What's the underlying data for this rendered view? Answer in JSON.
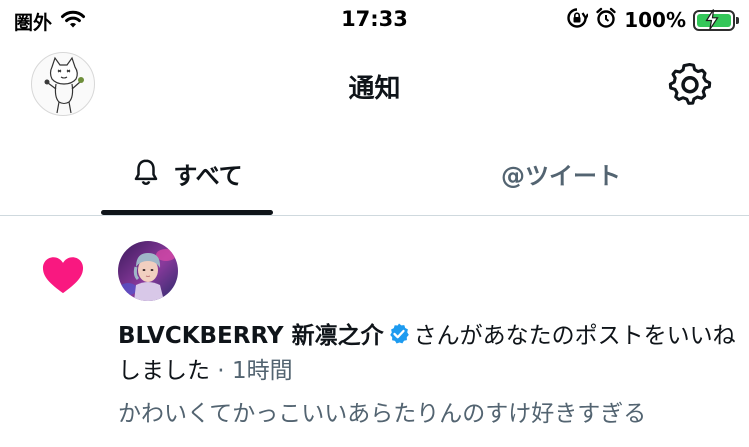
{
  "status_bar": {
    "carrier": "圏外",
    "time": "17:33",
    "battery_percent": "100%",
    "icons": [
      "wifi-icon",
      "rotation-lock-icon",
      "alarm-icon",
      "battery-charging-icon"
    ]
  },
  "header": {
    "title": "通知",
    "avatar_icon": "profile-avatar",
    "settings_icon": "gear-icon"
  },
  "tabs": [
    {
      "label": "すべて",
      "icon": "bell-icon",
      "selected": true
    },
    {
      "label": "@ツイート",
      "selected": false
    }
  ],
  "notification": {
    "type_icon": "heart-icon",
    "user_name": "BLVCKBERRY 新凛之介",
    "verified_icon": "verified-badge-icon",
    "action_text": "さんがあなたのポストをいいねしました",
    "separator": " · ",
    "time": "1時間",
    "preview": "かわいくてかっこいいあらたりんのすけ好きすぎる"
  },
  "colors": {
    "heart": "#f91880",
    "verified": "#1d9bf0",
    "battery": "#34c759",
    "text_primary": "#0f1419",
    "text_secondary": "#536471"
  }
}
